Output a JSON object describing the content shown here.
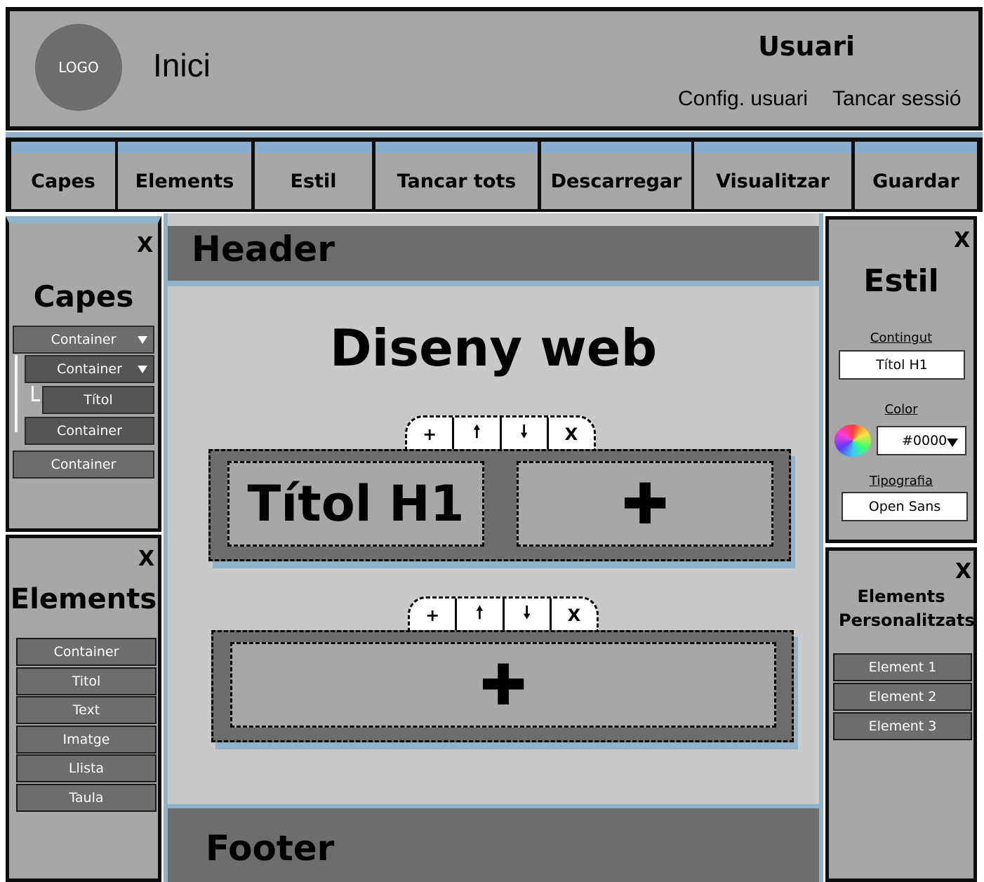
{
  "header": {
    "logo": "LOGO",
    "home": "Inici",
    "user": "Usuari",
    "user_settings": "Config. usuari",
    "logout": "Tancar sessió"
  },
  "toolbar": [
    "Capes",
    "Elements",
    "Estil",
    "Tancar tots",
    "Descarregar",
    "Visualitzar",
    "Guardar"
  ],
  "layers_panel": {
    "title": "Capes",
    "close": "X",
    "items": [
      "Container",
      "Container",
      "Títol",
      "Container",
      "Container"
    ]
  },
  "elements_panel": {
    "title": "Elements",
    "close": "X",
    "items": [
      "Container",
      "Titol",
      "Text",
      "Imatge",
      "Llista",
      "Taula"
    ]
  },
  "canvas": {
    "header": "Header",
    "title": "Diseny web",
    "heading": "Títol H1",
    "footer": "Footer",
    "controls": [
      "+",
      "🠕",
      "🠗",
      "X"
    ]
  },
  "style_panel": {
    "title": "Estil",
    "close": "X",
    "content_label": "Contingut",
    "content_value": "Títol H1",
    "color_label": "Color",
    "color_value": "#0000",
    "font_label": "Tipografia",
    "font_value": "Open Sans"
  },
  "custom_panel": {
    "title": "Elements Personalitzats",
    "close": "X",
    "items": [
      "Element 1",
      "Element 2",
      "Element 3"
    ]
  }
}
